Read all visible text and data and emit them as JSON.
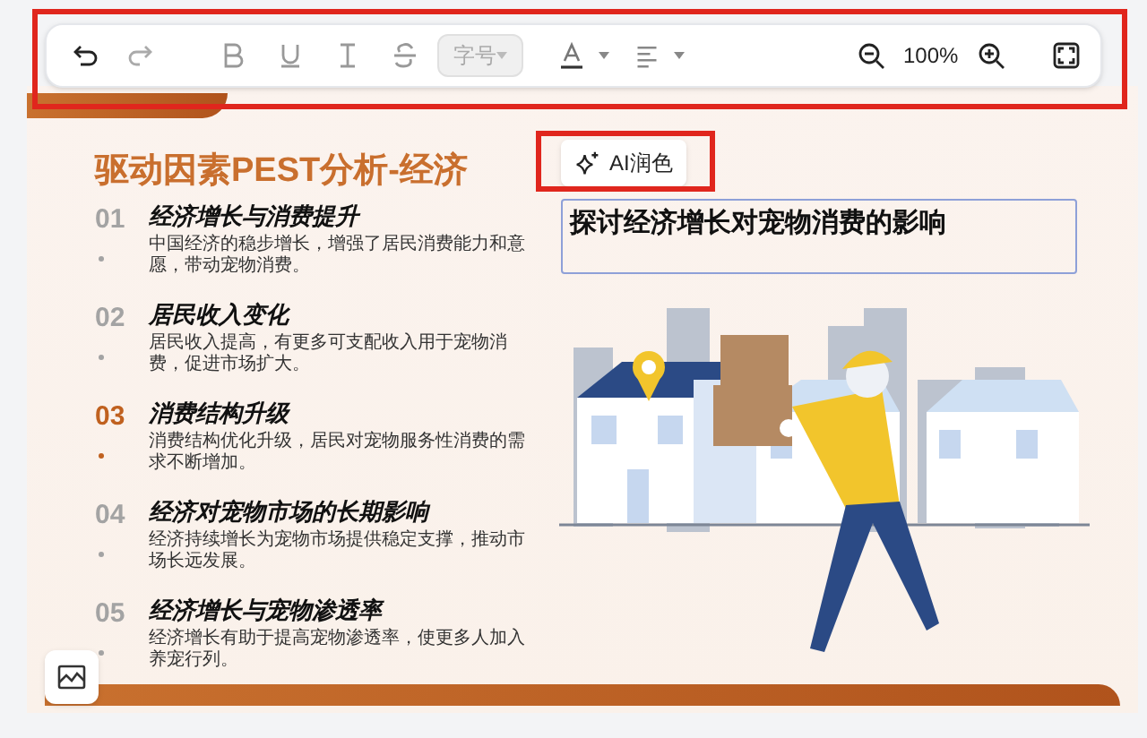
{
  "toolbar": {
    "highlighted": true,
    "font_size_placeholder": "字号",
    "zoom": "100%"
  },
  "slide": {
    "title": "驱动因素PEST分析-经济",
    "items": [
      {
        "number": "01",
        "heading": "经济增长与消费提升",
        "text": "中国经济的稳步增长，增强了居民消费能力和意愿，带动宠物消费。",
        "selected": false
      },
      {
        "number": "02",
        "heading": "居民收入变化",
        "text": "居民收入提高，有更多可支配收入用于宠物消费，促进市场扩大。",
        "selected": false
      },
      {
        "number": "03",
        "heading": "消费结构升级",
        "text": "消费结构优化升级，居民对宠物服务性消费的需求不断增加。",
        "selected": true
      },
      {
        "number": "04",
        "heading": "经济对宠物市场的长期影响",
        "text": "经济持续增长为宠物市场提供稳定支撑，推动市场长远发展。",
        "selected": false
      },
      {
        "number": "05",
        "heading": "经济增长与宠物渗透率",
        "text": "经济增长有助于提高宠物渗透率，使更多人加入养宠行列。",
        "selected": false
      }
    ],
    "ai_button": {
      "label": "AI润色",
      "highlighted": true
    },
    "text_box": {
      "value": "探讨经济增长对宠物消费的影响"
    }
  }
}
